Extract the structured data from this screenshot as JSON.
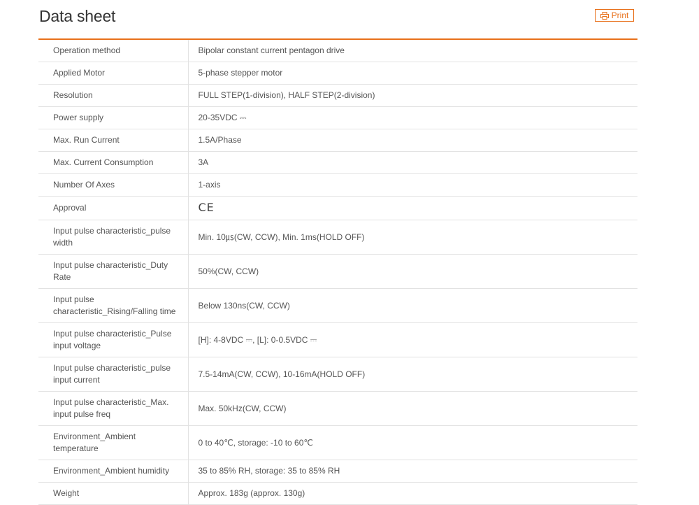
{
  "page": {
    "title": "Data sheet",
    "print_label": "Print"
  },
  "colors": {
    "accent": "#e8701a",
    "border": "#e2e2e2",
    "text": "#555555"
  },
  "spec_rows": [
    {
      "label": "Operation method",
      "value": "Bipolar constant current pentagon drive"
    },
    {
      "label": "Applied Motor",
      "value": "5-phase stepper motor"
    },
    {
      "label": "Resolution",
      "value": "FULL STEP(1-division), HALF STEP(2-division)"
    },
    {
      "label": "Power supply",
      "value": "20-35VDC ⎓"
    },
    {
      "label": "Max. Run Current",
      "value": "1.5A/Phase"
    },
    {
      "label": "Max. Current Consumption",
      "value": "3A"
    },
    {
      "label": "Number Of Axes",
      "value": "1-axis"
    },
    {
      "label": "Approval",
      "value": "CE"
    },
    {
      "label": "Input pulse characteristic_pulse width",
      "value": "Min. 10㎲(CW, CCW), Min. 1ms(HOLD OFF)"
    },
    {
      "label": "Input pulse characteristic_Duty Rate",
      "value": "50%(CW, CCW)"
    },
    {
      "label": "Input pulse characteristic_Rising/Falling time",
      "value": "Below 130ns(CW, CCW)"
    },
    {
      "label": "Input pulse characteristic_Pulse input voltage",
      "value": "[H]: 4-8VDC ⎓, [L]: 0-0.5VDC ⎓"
    },
    {
      "label": "Input pulse characteristic_pulse input current",
      "value": "7.5-14mA(CW, CCW), 10-16mA(HOLD OFF)"
    },
    {
      "label": "Input pulse characteristic_Max. input pulse freq",
      "value": "Max. 50kHz(CW, CCW)"
    },
    {
      "label": "Environment_Ambient temperature",
      "value": "0 to 40℃, storage: -10 to 60℃"
    },
    {
      "label": "Environment_Ambient humidity",
      "value": "35 to 85% RH, storage: 35 to 85% RH"
    },
    {
      "label": "Weight",
      "value": "Approx. 183g (approx. 130g)"
    }
  ]
}
